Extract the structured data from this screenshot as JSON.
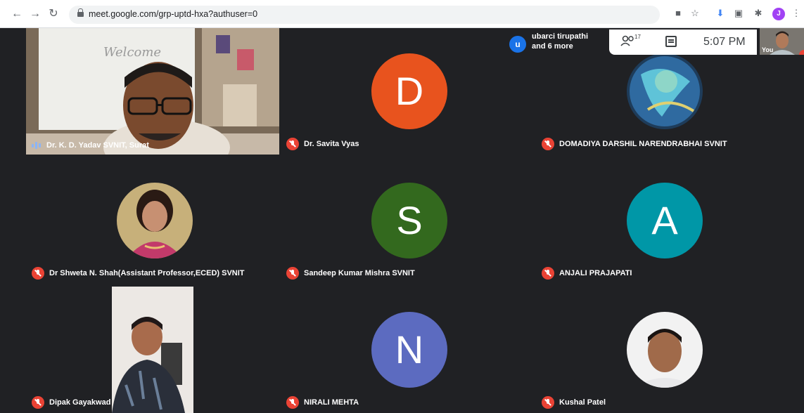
{
  "browser": {
    "url": "meet.google.com/grp-uptd-hxa?authuser=0",
    "profile_initial": "J"
  },
  "meet": {
    "chip": {
      "avatar_initial": "u",
      "line1": "ubarci tirupathi",
      "line2": "and 6 more"
    },
    "people_count": "17",
    "time": "5:07 PM",
    "self_label": "You"
  },
  "participants": [
    {
      "name": "Dr. K. D. Yadav SVNIT, Surat",
      "type": "video",
      "state": "speaking"
    },
    {
      "name": "Dr. Savita Vyas",
      "type": "avatar",
      "initial": "D",
      "color": "#e8531e",
      "state": "muted"
    },
    {
      "name": "DOMADIYA DARSHIL NARENDRABHAI SVNIT",
      "type": "photo",
      "state": "muted"
    },
    {
      "name": "Dr Shweta N. Shah(Assistant Professor,ECED) SVNIT",
      "type": "photo",
      "state": "muted"
    },
    {
      "name": "Sandeep Kumar Mishra SVNIT",
      "type": "avatar",
      "initial": "S",
      "color": "#33691e",
      "state": "muted"
    },
    {
      "name": "ANJALI PRAJAPATI",
      "type": "avatar",
      "initial": "A",
      "color": "#0097a7",
      "state": "muted"
    },
    {
      "name": "Dipak Gayakwad",
      "type": "video",
      "state": "muted"
    },
    {
      "name": "NIRALI MEHTA",
      "type": "avatar",
      "initial": "N",
      "color": "#5c6bc0",
      "state": "muted"
    },
    {
      "name": "Kushal Patel",
      "type": "photo",
      "state": "muted"
    }
  ]
}
